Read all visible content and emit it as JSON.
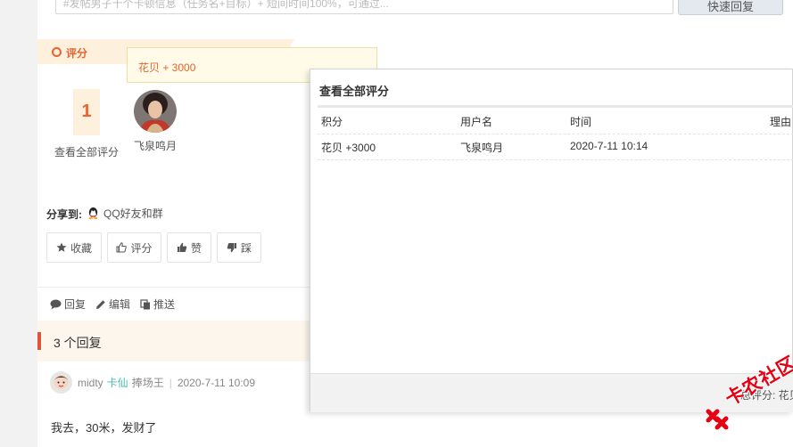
{
  "reply_box": {
    "placeholder": "#发帖男子十个卡顿信息（任务名+目标）+ 短间时间100%，可通过...",
    "quick_reply_label": "快速回复"
  },
  "rating": {
    "section_label": "评分",
    "tooltip": "花贝 + 3000",
    "count": "1",
    "view_all_label": "查看全部评分",
    "rater_name": "飞泉鸣月"
  },
  "share": {
    "label": "分享到:",
    "qq_label": "QQ好友和群"
  },
  "actions": {
    "favorite": "收藏",
    "rate": "评分",
    "like": "赞",
    "dislike": "踩"
  },
  "post_actions": {
    "reply": "回复",
    "edit": "编辑",
    "push": "推送"
  },
  "replies": {
    "count_label": "3 个回复",
    "first": {
      "author": "midty",
      "tag": "卡仙",
      "title": "捧场王",
      "time": "2020-7-11 10:09",
      "content": "我去，30米，发财了"
    }
  },
  "dialog": {
    "title": "查看全部评分",
    "columns": [
      "积分",
      "用户名",
      "时间",
      "理由"
    ],
    "rows": [
      {
        "score": "花贝 +3000",
        "user": "飞泉鸣月",
        "time": "2020-7-11 10:14",
        "reason": ""
      }
    ],
    "footer_text": "总评分: 花贝 +"
  },
  "watermark": "卡农社区",
  "colors": {
    "accent": "#e8632d",
    "ribbon_bg": "#fdf0dc",
    "tag_teal": "#4bb8b0",
    "reply_mark": "#e0533b"
  }
}
